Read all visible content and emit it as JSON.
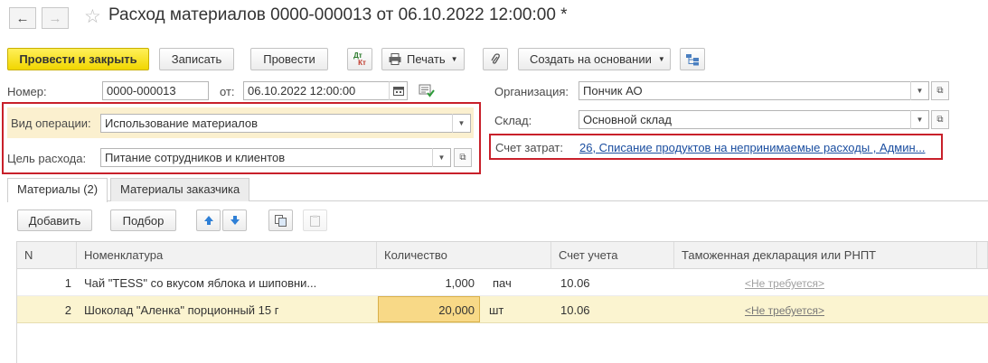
{
  "window": {
    "title": "Расход материалов 0000-000013 от 06.10.2022 12:00:00 *",
    "back_glyph": "←",
    "forward_glyph": "→",
    "star_glyph": "☆"
  },
  "toolbar": {
    "post_close": "Провести и закрыть",
    "save": "Записать",
    "post": "Провести",
    "dtkt_top": "Дт",
    "dtkt_bottom": "Кт",
    "print": "Печать",
    "create_based": "Создать на основании"
  },
  "header": {
    "number_label": "Номер:",
    "number_value": "0000-000013",
    "date_label": "от:",
    "date_value": "06.10.2022 12:00:00",
    "org_label": "Организация:",
    "org_value": "Пончик АО",
    "operation_label": "Вид операции:",
    "operation_value": "Использование материалов",
    "warehouse_label": "Склад:",
    "warehouse_value": "Основной склад",
    "cost_account_label": "Счет затрат:",
    "cost_account_value": "26, Списание продуктов на непринимаемые расходы , Админ...",
    "purpose_label": "Цель расхода:",
    "purpose_value": "Питание сотрудников и клиентов"
  },
  "tabs": [
    {
      "label": "Материалы (2)"
    },
    {
      "label": "Материалы заказчика"
    }
  ],
  "table_toolbar": {
    "add": "Добавить",
    "pick": "Подбор"
  },
  "table": {
    "columns": [
      "N",
      "Номенклатура",
      "Количество",
      "Счет учета",
      "Таможенная декларация или РНПТ"
    ],
    "rows": [
      {
        "n": "1",
        "item": "Чай \"TESS\" со вкусом яблока и шиповни...",
        "qty": "1,000",
        "unit": "пач",
        "account": "10.06",
        "customs": "<Не требуется>"
      },
      {
        "n": "2",
        "item": "Шоколад \"Аленка\" порционный 15 г",
        "qty": "20,000",
        "unit": "шт",
        "account": "10.06",
        "customs": "<Не требуется>"
      }
    ]
  },
  "colors": {
    "primary_button": "#f5dc18",
    "highlight_row": "#fbf4d0",
    "active_cell": "#f8d987",
    "red_frame": "#c8202a",
    "link": "#1b4ea0"
  }
}
